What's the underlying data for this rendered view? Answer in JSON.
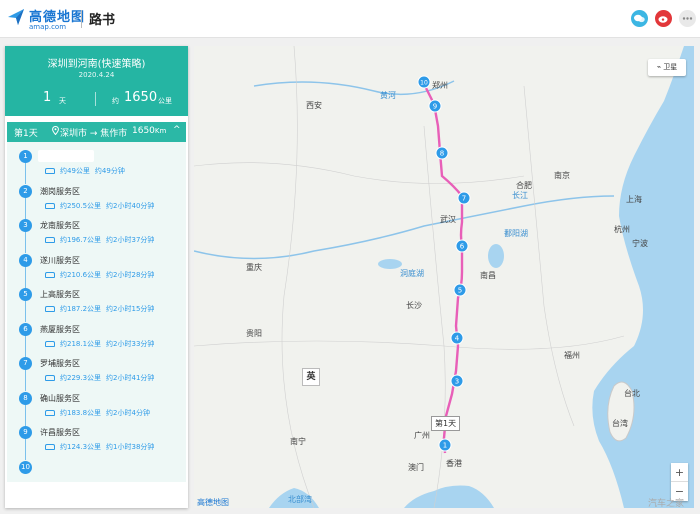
{
  "brand": {
    "logo_text": "高德地图",
    "logo_sub": "amap.com",
    "app_title": "路书"
  },
  "share": [
    {
      "icon": "wechat-icon",
      "color": "#3cb6e3"
    },
    {
      "icon": "weibo-icon",
      "color": "#e2373a"
    },
    {
      "icon": "more-icon",
      "color": "#e9e9e9"
    }
  ],
  "summary": {
    "title": "深圳到河南(快速策略)",
    "date": "2020.4.24",
    "days": "1",
    "days_unit": "天",
    "dist_prefix": "约",
    "distance": "1650",
    "distance_unit": "公里"
  },
  "day": {
    "label": "第1天",
    "route": "深圳市 → 焦作市",
    "distance": "1650",
    "distance_unit": "Km",
    "toggle": "^"
  },
  "stops": [
    {
      "num": "1",
      "name": "",
      "seg_dist": "约49公里",
      "seg_time": "约49分钟"
    },
    {
      "num": "2",
      "name": "潮岗服务区",
      "seg_dist": "约250.5公里",
      "seg_time": "约2小时40分钟"
    },
    {
      "num": "3",
      "name": "龙南服务区",
      "seg_dist": "约196.7公里",
      "seg_time": "约2小时37分钟"
    },
    {
      "num": "4",
      "name": "遂川服务区",
      "seg_dist": "约210.6公里",
      "seg_time": "约2小时28分钟"
    },
    {
      "num": "5",
      "name": "上高服务区",
      "seg_dist": "约187.2公里",
      "seg_time": "约2小时15分钟"
    },
    {
      "num": "6",
      "name": "燕厦服务区",
      "seg_dist": "约218.1公里",
      "seg_time": "约2小时33分钟"
    },
    {
      "num": "7",
      "name": "罗埔服务区",
      "seg_dist": "约229.3公里",
      "seg_time": "约2小时41分钟"
    },
    {
      "num": "8",
      "name": "确山服务区",
      "seg_dist": "约183.8公里",
      "seg_time": "约2小时4分钟"
    },
    {
      "num": "9",
      "name": "许昌服务区",
      "seg_dist": "约124.3公里",
      "seg_time": "约1小时38分钟"
    },
    {
      "num": "10",
      "name": "",
      "seg_dist": "",
      "seg_time": ""
    }
  ],
  "map": {
    "satellite_label": "卫星",
    "zoom_in": "+",
    "zoom_out": "−",
    "logo": "高德地图",
    "watermark": "汽车之家",
    "day_tag": "第1天",
    "country_label": "英",
    "route_color": "#e85fb8",
    "marker_color": "#2e9be8",
    "markers": [
      "10",
      "9",
      "8",
      "7",
      "6",
      "5",
      "4",
      "3",
      "1"
    ],
    "cities": [
      {
        "name": "郑州"
      },
      {
        "name": "西安"
      },
      {
        "name": "合肥"
      },
      {
        "name": "南京"
      },
      {
        "name": "上海"
      },
      {
        "name": "武汉"
      },
      {
        "name": "杭州"
      },
      {
        "name": "南昌"
      },
      {
        "name": "长沙"
      },
      {
        "name": "重庆"
      },
      {
        "name": "贵阳"
      },
      {
        "name": "福州"
      },
      {
        "name": "台北"
      },
      {
        "name": "广州"
      },
      {
        "name": "南宁"
      },
      {
        "name": "香港"
      },
      {
        "name": "澳门"
      },
      {
        "name": "台湾"
      },
      {
        "name": "宁波"
      },
      {
        "name": "洞庭湖"
      },
      {
        "name": "鄱阳湖"
      },
      {
        "name": "长江"
      },
      {
        "name": "黄河"
      },
      {
        "name": "北部湾"
      }
    ]
  }
}
